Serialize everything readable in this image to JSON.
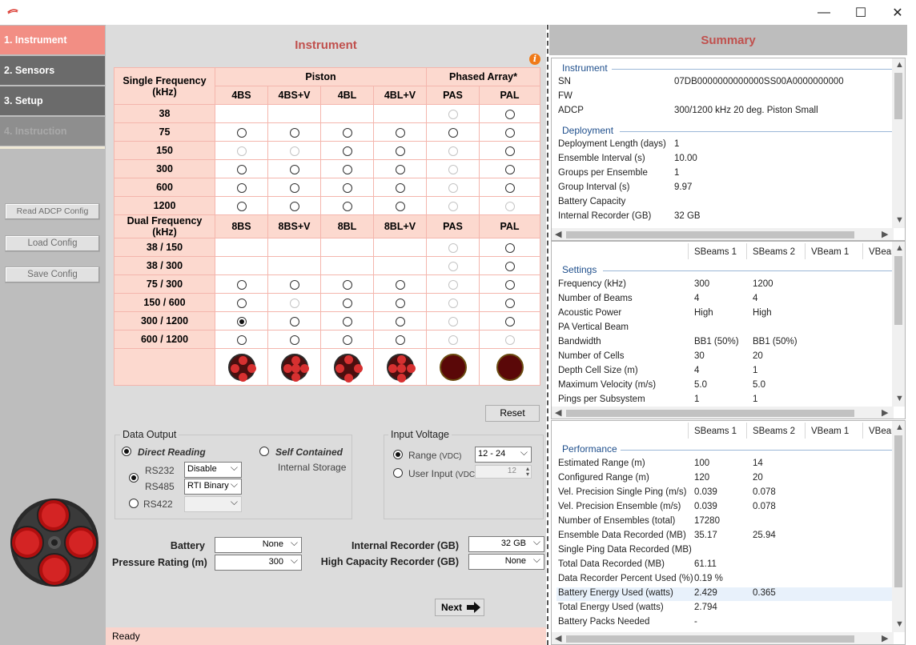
{
  "window": {
    "minimize": "—",
    "maximize": "☐",
    "close": "✕"
  },
  "nav": [
    {
      "label": "1. Instrument"
    },
    {
      "label": "2. Sensors"
    },
    {
      "label": "3. Setup"
    },
    {
      "label": "4. Instruction"
    }
  ],
  "side_buttons": {
    "read": "Read ADCP Config",
    "load": "Load Config",
    "save": "Save Config"
  },
  "main": {
    "title": "Instrument",
    "info": "i",
    "table": {
      "single_header": "Single Frequency (kHz)",
      "piston": "Piston",
      "phased": "Phased Array*",
      "single_cols": [
        "4BS",
        "4BS+V",
        "4BL",
        "4BL+V",
        "PAS",
        "PAL"
      ],
      "dual_header": "Dual Frequency (kHz)",
      "dual_cols": [
        "8BS",
        "8BS+V",
        "8BL",
        "8BL+V",
        "PAS",
        "PAL"
      ],
      "single_rows": [
        {
          "label": "38",
          "cells": [
            "",
            "",
            "",
            "",
            "dis",
            "on"
          ]
        },
        {
          "label": "75",
          "cells": [
            "on",
            "on",
            "on",
            "on",
            "on",
            "on"
          ]
        },
        {
          "label": "150",
          "cells": [
            "dis",
            "dis",
            "on",
            "on",
            "dis",
            "on"
          ]
        },
        {
          "label": "300",
          "cells": [
            "on",
            "on",
            "on",
            "on",
            "dis",
            "on"
          ]
        },
        {
          "label": "600",
          "cells": [
            "on",
            "on",
            "on",
            "on",
            "dis",
            "on"
          ]
        },
        {
          "label": "1200",
          "cells": [
            "on",
            "on",
            "on",
            "on",
            "dis",
            "dis"
          ]
        }
      ],
      "dual_rows": [
        {
          "label": "38 / 150",
          "cells": [
            "",
            "",
            "",
            "",
            "dis",
            "on"
          ]
        },
        {
          "label": "38 / 300",
          "cells": [
            "",
            "",
            "",
            "",
            "dis",
            "on"
          ]
        },
        {
          "label": "75 / 300",
          "cells": [
            "on",
            "on",
            "on",
            "on",
            "dis",
            "on"
          ]
        },
        {
          "label": "150 / 600",
          "cells": [
            "on",
            "dis",
            "on",
            "on",
            "dis",
            "on"
          ]
        },
        {
          "label": "300 / 1200",
          "cells": [
            "sel",
            "on",
            "on",
            "on",
            "dis",
            "on"
          ]
        },
        {
          "label": "600 / 1200",
          "cells": [
            "on",
            "on",
            "on",
            "on",
            "dis",
            "dis"
          ]
        }
      ]
    },
    "reset": "Reset",
    "data_output": {
      "title": "Data Output",
      "direct": "Direct Reading",
      "self": "Self Contained",
      "internal": "Internal Storage",
      "rs232": "RS232",
      "rs485": "RS485",
      "rs422": "RS422",
      "rs232_value": "Disable",
      "rs485_value": "RTI Binary",
      "rs422_value": ""
    },
    "input_voltage": {
      "title": "Input Voltage",
      "range": "Range",
      "range_unit": "(VDC)",
      "range_value": "12 - 24",
      "user": "User Input",
      "user_unit": "(VDC)",
      "user_value": "12"
    },
    "battery": {
      "label": "Battery",
      "value": "None"
    },
    "pressure": {
      "label": "Pressure Rating (m)",
      "value": "300"
    },
    "internal_rec": {
      "label": "Internal Recorder (GB)",
      "value": "32 GB"
    },
    "high_cap": {
      "label": "High Capacity Recorder (GB)",
      "value": "None"
    },
    "next": "Next",
    "status": "Ready"
  },
  "summary": {
    "title": "Summary",
    "instrument": {
      "title": "Instrument",
      "rows": [
        {
          "k": "SN",
          "v": "07DB0000000000000SS00A0000000000"
        },
        {
          "k": "FW",
          "v": ""
        },
        {
          "k": "ADCP",
          "v": "300/1200 kHz 20 deg. Piston Small"
        }
      ]
    },
    "deployment": {
      "title": "Deployment",
      "rows": [
        {
          "k": "Deployment Length (days)",
          "v": "1"
        },
        {
          "k": "Ensemble Interval (s)",
          "v": "10.00"
        },
        {
          "k": "Groups per Ensemble",
          "v": "1"
        },
        {
          "k": "Group Interval (s)",
          "v": "9.97"
        },
        {
          "k": "Battery Capacity",
          "v": ""
        },
        {
          "k": "Internal Recorder (GB)",
          "v": "32 GB"
        }
      ]
    },
    "columns": [
      "SBeams 1",
      "SBeams 2",
      "VBeam 1",
      "VBean"
    ],
    "settings": {
      "title": "Settings",
      "rows": [
        {
          "k": "Frequency (kHz)",
          "a": "300",
          "b": "1200"
        },
        {
          "k": "Number of Beams",
          "a": "4",
          "b": "4"
        },
        {
          "k": "Acoustic Power",
          "a": "High",
          "b": "High"
        },
        {
          "k": "PA Vertical Beam",
          "a": "",
          "b": ""
        },
        {
          "k": "Bandwidth",
          "a": "BB1 (50%)",
          "b": "BB1 (50%)"
        },
        {
          "k": "Number of Cells",
          "a": "30",
          "b": "20"
        },
        {
          "k": "Depth Cell Size (m)",
          "a": "4",
          "b": "1"
        },
        {
          "k": "Maximum Velocity (m/s)",
          "a": "5.0",
          "b": "5.0"
        },
        {
          "k": "Pings per Subsystem",
          "a": "1",
          "b": "1"
        }
      ]
    },
    "performance": {
      "title": "Performance",
      "rows": [
        {
          "k": "Estimated Range (m)",
          "a": "100",
          "b": "14"
        },
        {
          "k": "Configured Range (m)",
          "a": "120",
          "b": "20"
        },
        {
          "k": "Vel. Precision Single Ping (m/s)",
          "a": "0.039",
          "b": "0.078"
        },
        {
          "k": "Vel. Precision Ensemble (m/s)",
          "a": "0.039",
          "b": "0.078"
        },
        {
          "k": "Number of Ensembles (total)",
          "a": "17280",
          "b": ""
        },
        {
          "k": "Ensemble Data Recorded (MB)",
          "a": "35.17",
          "b": "25.94"
        },
        {
          "k": "Single Ping Data Recorded (MB)",
          "a": "",
          "b": ""
        },
        {
          "k": "Total Data Recorded (MB)",
          "a": "61.11",
          "b": ""
        },
        {
          "k": "Data Recorder Percent Used (%)",
          "a": "0.19 %",
          "b": ""
        },
        {
          "k": "Battery Energy Used (watts)",
          "a": "2.429",
          "b": "0.365"
        },
        {
          "k": "Total Energy Used (watts)",
          "a": "2.794",
          "b": ""
        },
        {
          "k": "Battery Packs Needed",
          "a": "-",
          "b": ""
        }
      ]
    }
  },
  "colors": {
    "accent": "#c0504d",
    "nav_active": "#f28e84",
    "table_header": "#fcd9cf",
    "section": "#1f4f8c"
  }
}
